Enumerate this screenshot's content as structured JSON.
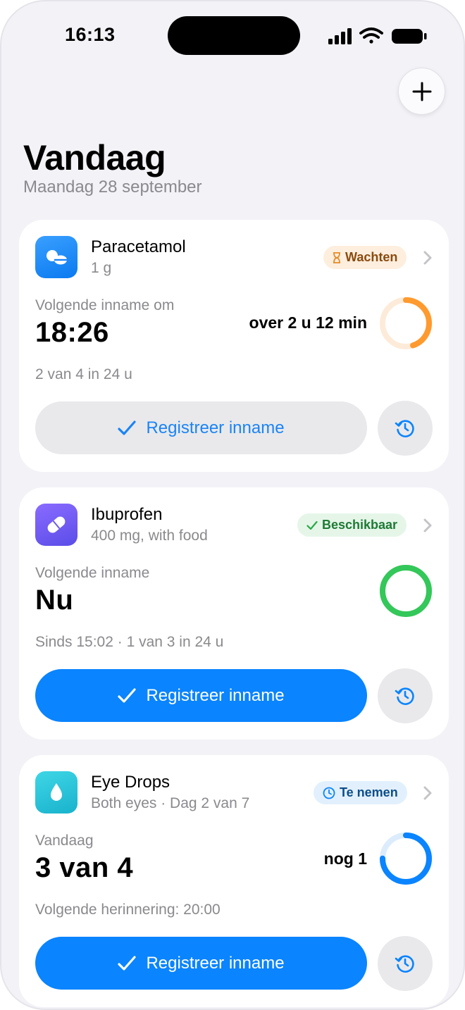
{
  "status_bar": {
    "time": "16:13"
  },
  "header": {
    "title": "Vandaag",
    "date": "Maandag 28 september"
  },
  "colors": {
    "accent": "#0a84ff",
    "orange": "#ff9a2e",
    "green": "#34c759",
    "blue_ring": "#0a84ff"
  },
  "cards": [
    {
      "name": "Paracetamol",
      "detail": "1 g",
      "icon": "pill-icon",
      "badge": "Wachten",
      "badge_icon": "hourglass-icon",
      "label": "Volgende inname om",
      "value": "18:26",
      "note": "over 2 u 12 min",
      "progress": 0.45,
      "info": "2 van 4 in 24 u",
      "button": "Registreer inname"
    },
    {
      "name": "Ibuprofen",
      "detail": "400 mg, with food",
      "icon": "capsule-icon",
      "badge": "Beschikbaar",
      "badge_icon": "checkmark-icon",
      "label": "Volgende inname",
      "value": "Nu",
      "note": "",
      "progress": 1.0,
      "info": "Sinds 15:02 · 1 van 3 in 24 u",
      "button": "Registreer inname"
    },
    {
      "name": "Eye Drops",
      "detail": "Both eyes · Dag 2 van 7",
      "icon": "drop-icon",
      "badge": "Te nemen",
      "badge_icon": "clock-icon",
      "label": "Vandaag",
      "value": "3 van 4",
      "note": "nog 1",
      "progress": 0.75,
      "info": "Volgende herinnering: 20:00",
      "button": "Registreer inname"
    }
  ]
}
